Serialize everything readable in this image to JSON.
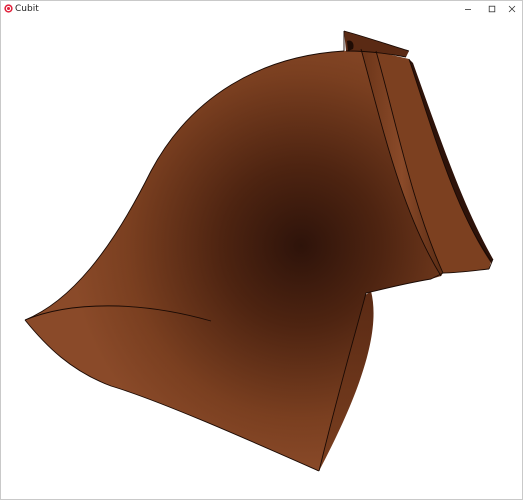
{
  "window": {
    "title": "Cubit",
    "icon": "cubit-logo-icon",
    "controls": [
      "minimize-icon",
      "maximize-icon",
      "close-icon"
    ]
  },
  "viewport": {
    "content": "3d-surface-mesh",
    "colors": {
      "surface_light": "#8a4a29",
      "surface_mid": "#6b3519",
      "surface_dark": "#2e130a",
      "edge": "#1a0a04",
      "background": "#ffffff"
    }
  }
}
